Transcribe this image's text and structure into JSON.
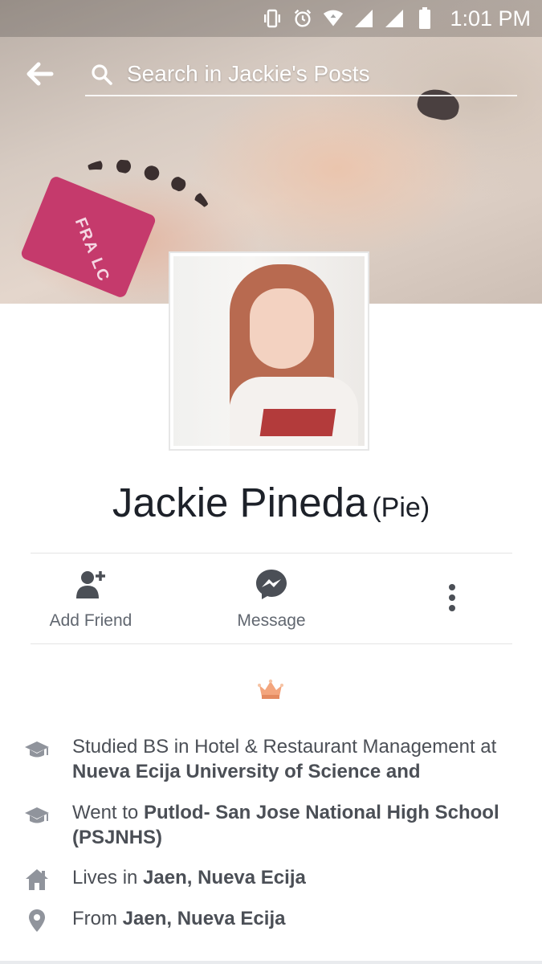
{
  "status_bar": {
    "time": "1:01 PM",
    "icons": [
      "vibrate-icon",
      "alarm-icon",
      "wifi-icon",
      "signal-icon",
      "signal-icon",
      "battery-icon"
    ]
  },
  "search": {
    "placeholder": "Search in Jackie's Posts"
  },
  "cover_photo": {
    "strap_text": "FRA LC"
  },
  "profile": {
    "name": "Jackie Pineda",
    "nickname": "(Pie)"
  },
  "actions": {
    "add_friend": "Add Friend",
    "message": "Message"
  },
  "bio": {
    "emoji": "👑"
  },
  "intro": [
    {
      "icon": "graduation-cap-icon",
      "prefix": "Studied BS in Hotel & Restaurant Management at ",
      "strong": "Nueva Ecija University of Science and"
    },
    {
      "icon": "graduation-cap-icon",
      "prefix": "Went to ",
      "strong": "Putlod- San Jose National High School (PSJNHS)"
    },
    {
      "icon": "home-icon",
      "prefix": "Lives in ",
      "strong": "Jaen, Nueva Ecija"
    },
    {
      "icon": "location-pin-icon",
      "prefix": "From ",
      "strong": "Jaen, Nueva Ecija"
    }
  ],
  "colors": {
    "messenger_blue": "#4b4f56",
    "text_dark": "#1d2129",
    "text_secondary": "#616770"
  }
}
